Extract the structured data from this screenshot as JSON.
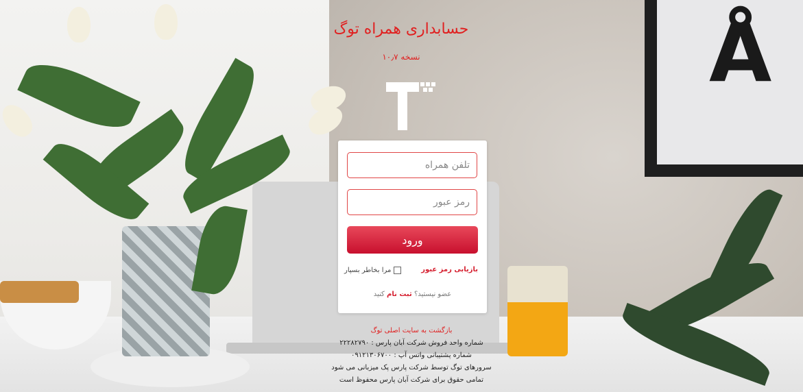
{
  "app": {
    "title": "حسابداری همراه توگ",
    "version": "نسخه ۱۰٫۷"
  },
  "logo_icon": "togh-logo-icon",
  "form": {
    "phone_placeholder": "تلفن همراه",
    "password_placeholder": "رمز عبور",
    "login_label": "ورود",
    "forgot_label": "بازیابی رمز عبور",
    "remember_label": "مرا بخاطر بسپار",
    "signup_prefix": "عضو نیستید؟",
    "signup_link": "ثبت نام",
    "signup_suffix": "کنید"
  },
  "footer": {
    "back_link": "بازگشت به سایت اصلی توگ",
    "sales_line": "شماره واحد فروش شرکت آبان پارس : ۲۲۲۸۲۷۹۰",
    "support_line": "شماره پشتیبانی واتس آپ : ۰۹۱۲۱۳۰۶۷۰۰",
    "servers_line": "سرورهای توگ توسط شرکت پارس پک میزبانی می شود",
    "rights_line": "تمامی حقوق برای شرکت آبان پارس محفوظ است"
  },
  "colors": {
    "accent": "#d51f2f",
    "title": "#e02020"
  }
}
